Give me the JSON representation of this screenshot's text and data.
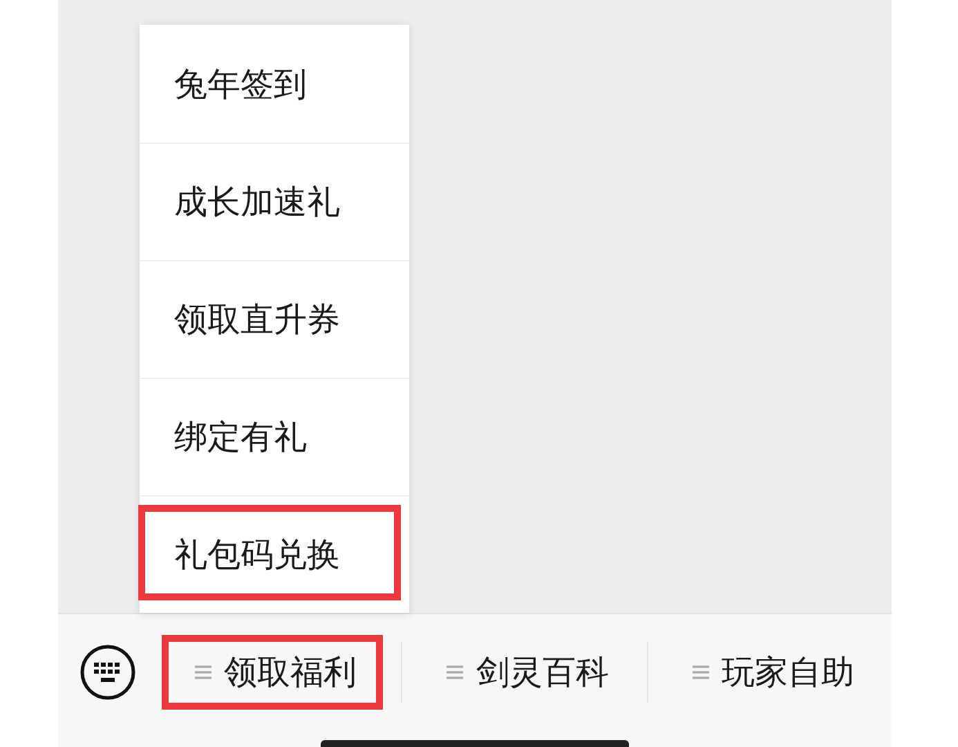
{
  "menu_popup": {
    "items": [
      {
        "label": "兔年签到",
        "highlighted": false
      },
      {
        "label": "成长加速礼",
        "highlighted": false
      },
      {
        "label": "领取直升券",
        "highlighted": false
      },
      {
        "label": "绑定有礼",
        "highlighted": false
      },
      {
        "label": "礼包码兑换",
        "highlighted": true
      }
    ]
  },
  "menu_bar": {
    "tabs": [
      {
        "label": "领取福利",
        "highlighted": true
      },
      {
        "label": "剑灵百科",
        "highlighted": false
      },
      {
        "label": "玩家自助",
        "highlighted": false
      }
    ]
  }
}
